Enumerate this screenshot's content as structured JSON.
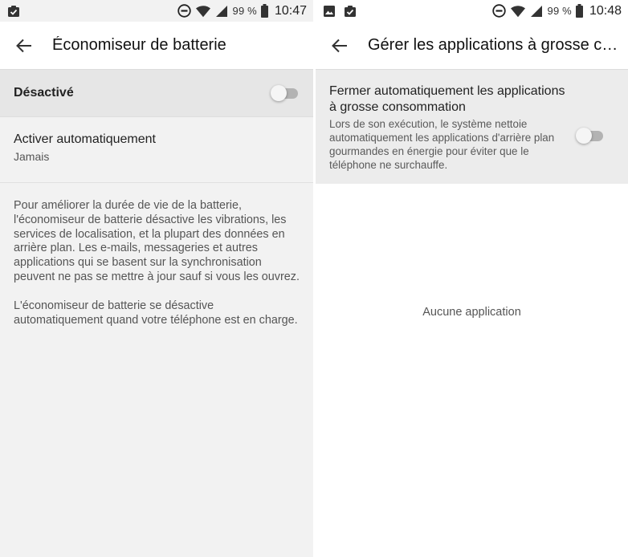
{
  "left": {
    "status_bar": {
      "left_icons": [
        "clipboard-check-icon"
      ],
      "battery_percent": "99 %",
      "time": "10:47"
    },
    "app_bar": {
      "title": "Économiseur de batterie"
    },
    "master_switch": {
      "label": "Désactivé",
      "checked": false
    },
    "auto_activate": {
      "title": "Activer automatiquement",
      "summary": "Jamais"
    },
    "footer": {
      "paragraph1": "Pour améliorer la durée de vie de la batterie, l'économiseur de batterie désactive les vibrations, les services de localisation, et la plupart des données en arrière plan. Les e-mails, messageries et autres applications qui se basent sur la synchronisation peuvent ne pas se mettre à jour sauf si vous les ouvrez.",
      "paragraph2": "L'économiseur de batterie se désactive automatiquement quand votre téléphone est en charge."
    }
  },
  "right": {
    "status_bar": {
      "left_icons": [
        "image-icon",
        "clipboard-check-icon"
      ],
      "battery_percent": "99 %",
      "time": "10:48"
    },
    "app_bar": {
      "title": "Gérer les applications à grosse consommation"
    },
    "auto_close": {
      "title": "Fermer automatiquement les applications à grosse consommation",
      "summary": "Lors de son exécution, le système nettoie automatiquement les applications d'arrière plan gourmandes en énergie pour éviter que le téléphone ne surchauffe.",
      "checked": false
    },
    "empty_state": "Aucune application"
  },
  "colors": {
    "left_background": "#f2f2f2",
    "master_row_background": "#e6e6e6",
    "switch_track_off": "#b3b3b3",
    "switch_thumb_off": "#f5f5f5"
  }
}
